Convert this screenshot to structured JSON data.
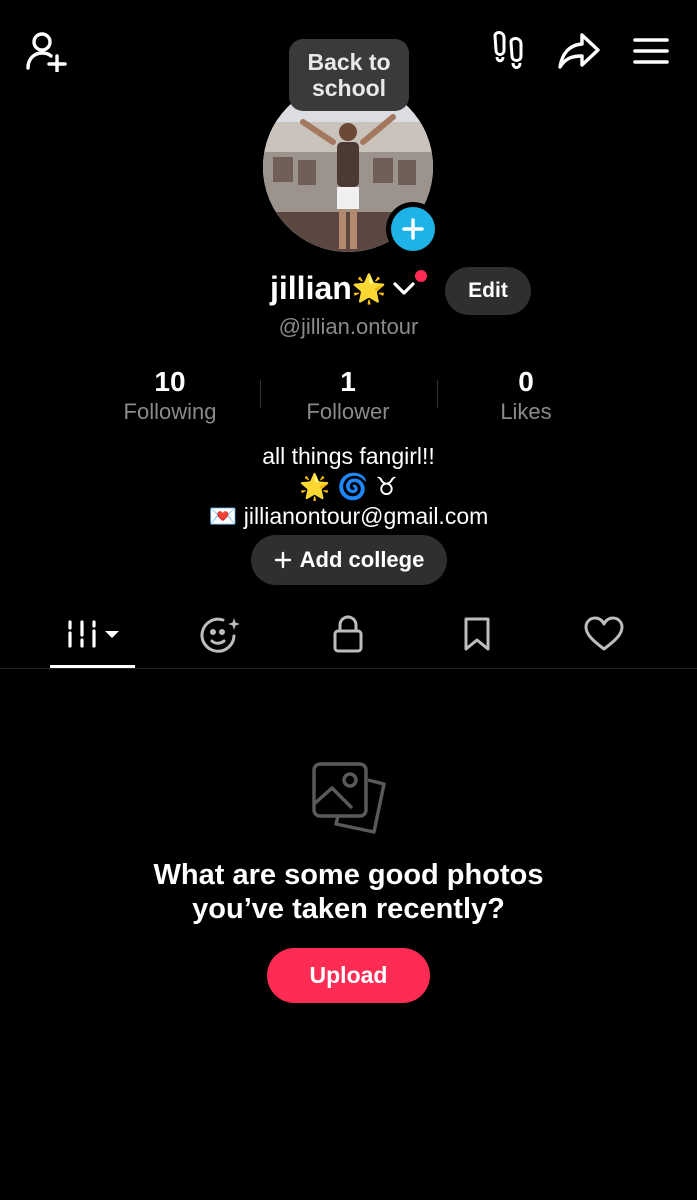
{
  "header": {
    "add_friend_icon": "person-plus-icon",
    "footprints_icon": "footprints-icon",
    "share_icon": "share-arrow-icon",
    "menu_icon": "hamburger-menu-icon"
  },
  "profile": {
    "bubble_text": "Back to\nschool",
    "name": "jillian",
    "name_emoji": "🌟",
    "handle": "@jillian.ontour",
    "edit_label": "Edit"
  },
  "stats": [
    {
      "value": "10",
      "label": "Following"
    },
    {
      "value": "1",
      "label": "Follower"
    },
    {
      "value": "0",
      "label": "Likes"
    }
  ],
  "bio": {
    "line1": "all things fangirl!!",
    "line2": "🌟 🌀 ♉",
    "email_emoji": "💌",
    "email": "jillianontour@gmail.com",
    "add_college_label": "Add college"
  },
  "tabs": [
    {
      "name": "grid",
      "icon": "grid-dropdown-icon",
      "active": true
    },
    {
      "name": "reposts",
      "icon": "sparkle-face-icon"
    },
    {
      "name": "private",
      "icon": "lock-icon"
    },
    {
      "name": "saved",
      "icon": "bookmark-icon"
    },
    {
      "name": "liked",
      "icon": "heart-icon"
    }
  ],
  "empty_state": {
    "icon": "photos-stack-icon",
    "title": "What are some good photos\nyou’ve taken recently?",
    "upload_label": "Upload"
  },
  "colors": {
    "accent": "#fe2c55",
    "avatar_add": "#1fb2e6",
    "button_bg": "#2f2f2f",
    "muted_text": "#8a8a8a"
  }
}
